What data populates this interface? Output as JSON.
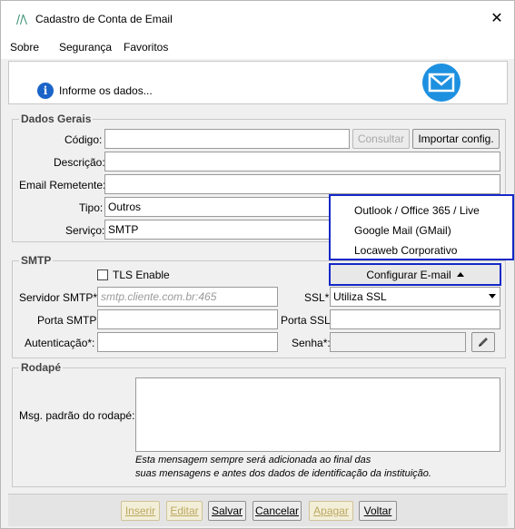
{
  "window": {
    "title": "Cadastro de Conta de Email",
    "close_glyph": "✕"
  },
  "menu": [
    "Sobre",
    "Segurança",
    "Favoritos"
  ],
  "header": {
    "info_glyph": "i",
    "info_text": "Informe os dados..."
  },
  "dados_gerais": {
    "title": "Dados Gerais",
    "codigo_label": "Código:",
    "codigo_value": "",
    "consultar_label": "Consultar",
    "importar_label": "Importar config.",
    "descricao_label": "Descrição:",
    "descricao_value": "",
    "email_label": "Email Remetente:",
    "email_value": "",
    "tipo_label": "Tipo:",
    "tipo_value": "Outros",
    "servico_label": "Serviço:",
    "servico_value": "SMTP"
  },
  "popup": {
    "items": [
      "Outlook / Office 365 / Live",
      "Google Mail (GMail)",
      "Locaweb Corporativo"
    ],
    "config_button": "Configurar E-mail"
  },
  "smtp": {
    "title": "SMTP",
    "tls_label": "TLS Enable",
    "tls_checked": false,
    "servidor_label": "Servidor SMTP*:",
    "servidor_placeholder": "smtp.cliente.com.br:465",
    "ssl_label": "SSL*:",
    "ssl_value": "Utiliza SSL",
    "porta_smtp_label": "Porta SMTP:",
    "porta_smtp_value": "",
    "porta_ssl_label": "Porta SSL:",
    "porta_ssl_value": "",
    "autenticacao_label": "Autenticação*:",
    "autenticacao_value": "",
    "senha_label": "Senha*:",
    "senha_value": ""
  },
  "rodape": {
    "title": "Rodapé",
    "msg_label": "Msg. padrão do rodapé:",
    "msg_value": "",
    "hint_line1": "Esta mensagem sempre será adicionada ao final das",
    "hint_line2": "suas mensagens e antes dos dados de identificação da instituição."
  },
  "footer": {
    "inserir": "Inserir",
    "editar": "Editar",
    "salvar": "Salvar",
    "cancelar": "Cancelar",
    "apagar": "Apagar",
    "voltar": "Voltar"
  },
  "colors": {
    "popup_border": "#1428c8",
    "mail_icon_bg": "#1e90e0",
    "info_icon_bg": "#1a64c8"
  }
}
